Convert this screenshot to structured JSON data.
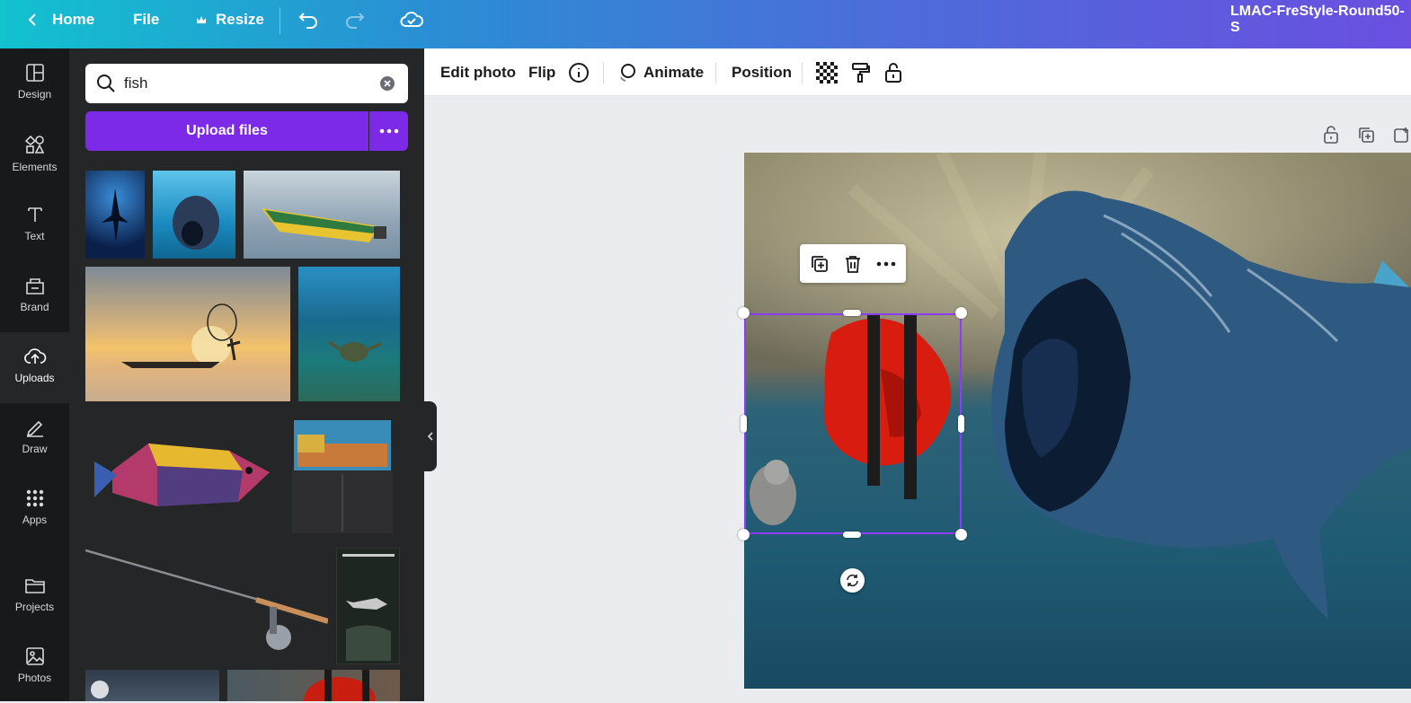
{
  "topbar": {
    "home_label": "Home",
    "file_label": "File",
    "resize_label": "Resize",
    "doc_title": "LMAC-FreStyle-Round50-S"
  },
  "rail": {
    "items": [
      {
        "label": "Design",
        "icon": "layout-icon"
      },
      {
        "label": "Elements",
        "icon": "shapes-icon"
      },
      {
        "label": "Text",
        "icon": "text-icon"
      },
      {
        "label": "Brand",
        "icon": "brand-icon"
      },
      {
        "label": "Uploads",
        "icon": "cloud-upload-icon",
        "active": true
      },
      {
        "label": "Draw",
        "icon": "pen-icon"
      },
      {
        "label": "Apps",
        "icon": "apps-grid-icon"
      },
      {
        "label": "Projects",
        "icon": "folder-icon"
      },
      {
        "label": "Photos",
        "icon": "image-icon"
      }
    ]
  },
  "panel": {
    "search_value": "fish",
    "upload_label": "Upload files"
  },
  "context_toolbar": {
    "edit_photo_label": "Edit photo",
    "flip_label": "Flip",
    "animate_label": "Animate",
    "position_label": "Position"
  },
  "colors": {
    "accent": "#7d2ae8",
    "rail_bg": "#18191b",
    "panel_bg": "#252627",
    "canvas_bg": "#ebecf0"
  }
}
